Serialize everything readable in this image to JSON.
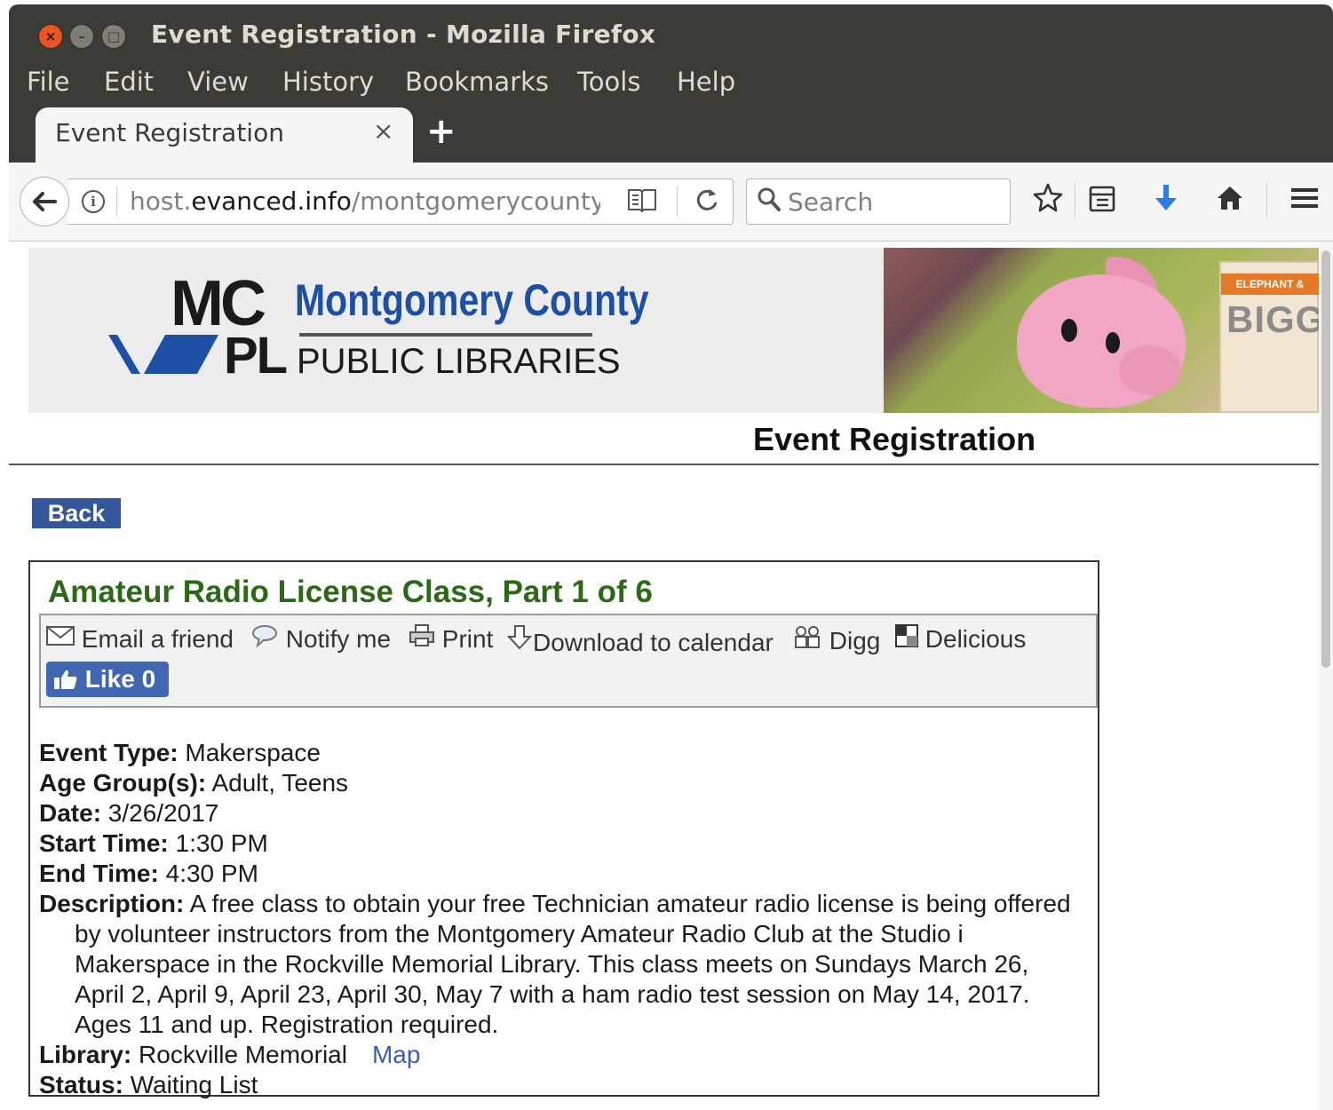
{
  "window": {
    "title": "Event Registration - Mozilla Firefox",
    "buttons": {
      "close": "×",
      "minimize": "–",
      "maximize": "□"
    }
  },
  "menu": [
    "File",
    "Edit",
    "View",
    "History",
    "Bookmarks",
    "Tools",
    "Help"
  ],
  "tab": {
    "title": "Event Registration",
    "close": "×",
    "new_tab": "+"
  },
  "navbar": {
    "back_glyph": "⟵",
    "info_glyph": "i",
    "url_prefix": "host.",
    "url_domain": "evanced.info",
    "url_path": "/montgomerycounty",
    "search_placeholder": "Search",
    "icons": [
      "back-icon",
      "info-icon",
      "reader-view-icon",
      "reload-icon",
      "search-icon",
      "star-icon",
      "library-icon",
      "download-icon",
      "home-icon",
      "hamburger-menu-icon"
    ],
    "download_color": "#2a7de1"
  },
  "banner": {
    "logo_mc": "MC",
    "logo_pl": "PL",
    "logo_county": "Montgomery County",
    "logo_public": "PUBLIC LIBRARIES",
    "book_band": "ELEPHANT &",
    "book_title": "BIGG"
  },
  "page": {
    "heading": "Event Registration",
    "back_button": "Back"
  },
  "event": {
    "title": "Amateur Radio License Class, Part 1 of 6",
    "share": {
      "email": "Email a friend",
      "notify": "Notify me",
      "print": "Print",
      "download": "Download to calendar",
      "digg": "Digg",
      "delicious": "Delicious",
      "like": "Like",
      "like_count": "0"
    },
    "fields": {
      "type_label": "Event Type:",
      "type_value": "Makerspace",
      "age_label": "Age Group(s):",
      "age_value": "Adult, Teens",
      "date_label": "Date:",
      "date_value": "3/26/2017",
      "start_label": "Start Time:",
      "start_value": "1:30 PM",
      "end_label": "End Time:",
      "end_value": "4:30 PM",
      "description_label": "Description:",
      "description_lines": [
        "A free class to obtain your free Technician amateur radio license is being offered",
        "by volunteer instructors from the Montgomery Amateur Radio Club at the Studio i",
        "Makerspace in the Rockville Memorial Library. This class meets on Sundays March 26,",
        "April 2, April 9, April 23, April 30, May 7 with a ham radio test session on May 14, 2017.",
        "Ages 11 and up. Registration required."
      ],
      "library_label": "Library:",
      "library_value": "Rockville Memorial",
      "map_link": "Map",
      "status_label": "Status:",
      "status_value": "Waiting List"
    },
    "colors": {
      "title": "#2b6a14",
      "back_button": "#34569b",
      "facebook": "#4267b2",
      "link": "#3a5fb5"
    }
  }
}
